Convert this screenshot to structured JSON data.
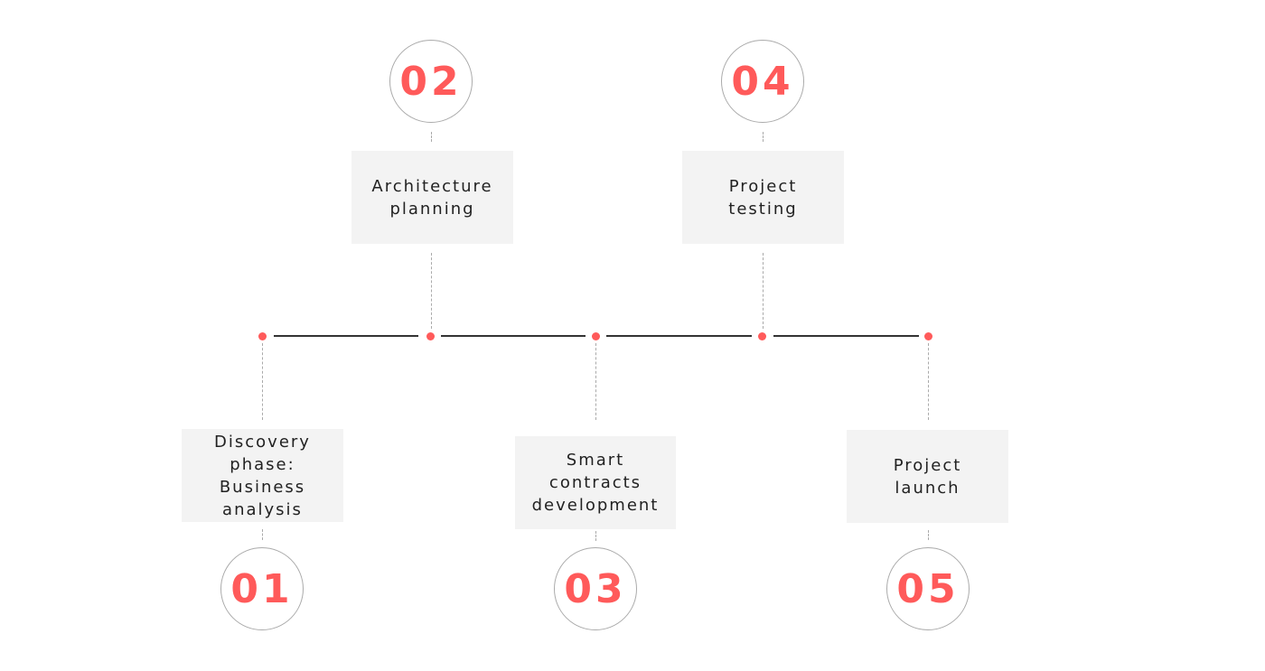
{
  "accent_color": "#ff5a5a",
  "steps": [
    {
      "number": "01",
      "label": "Discovery\nphase:\nBusiness\nanalysis",
      "position": "bottom"
    },
    {
      "number": "02",
      "label": "Architecture\nplanning",
      "position": "top"
    },
    {
      "number": "03",
      "label": "Smart\ncontracts\ndevelopment",
      "position": "bottom"
    },
    {
      "number": "04",
      "label": "Project\ntesting",
      "position": "top"
    },
    {
      "number": "05",
      "label": "Project\nlaunch",
      "position": "bottom"
    }
  ]
}
